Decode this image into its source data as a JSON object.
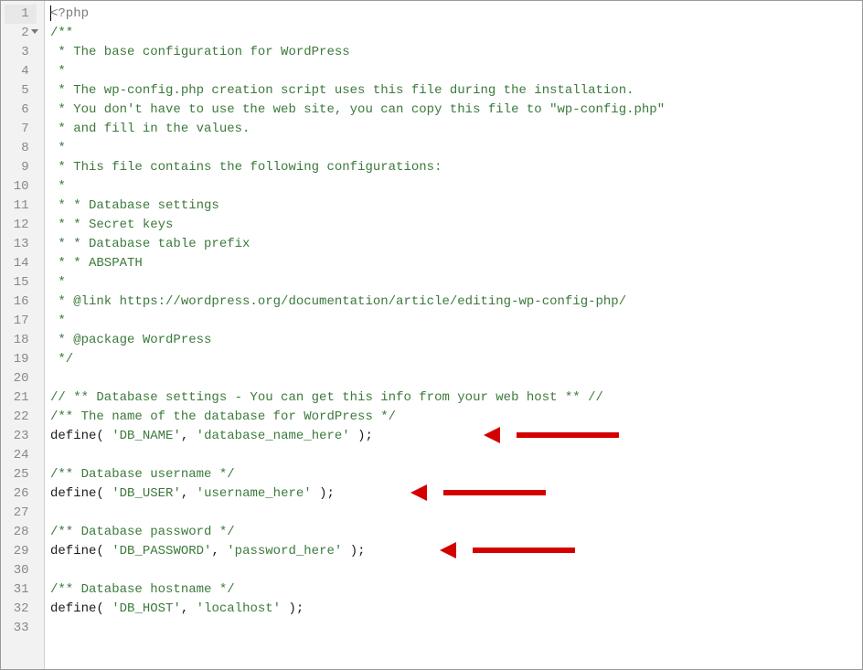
{
  "editor": {
    "total_lines": 33,
    "highlighted_line": 1,
    "fold_marker_line": 2,
    "lines": {
      "l1_open": "<?php",
      "l2": "/**",
      "l3": " * The base configuration for WordPress",
      "l4": " *",
      "l5": " * The wp-config.php creation script uses this file during the installation.",
      "l6": " * You don't have to use the web site, you can copy this file to \"wp-config.php\"",
      "l7": " * and fill in the values.",
      "l8": " *",
      "l9": " * This file contains the following configurations:",
      "l10": " *",
      "l11": " * * Database settings",
      "l12": " * * Secret keys",
      "l13": " * * Database table prefix",
      "l14": " * * ABSPATH",
      "l15": " *",
      "l16": " * @link https://wordpress.org/documentation/article/editing-wp-config-php/",
      "l17": " *",
      "l18": " * @package WordPress",
      "l19": " */",
      "l20": "",
      "l21": "// ** Database settings - You can get this info from your web host ** //",
      "l22": "/** The name of the database for WordPress */",
      "l23_fn": "define",
      "l23_a1": "'DB_NAME'",
      "l23_a2": "'database_name_here'",
      "l24": "",
      "l25": "/** Database username */",
      "l26_fn": "define",
      "l26_a1": "'DB_USER'",
      "l26_a2": "'username_here'",
      "l27": "",
      "l28": "/** Database password */",
      "l29_fn": "define",
      "l29_a1": "'DB_PASSWORD'",
      "l29_a2": "'password_here'",
      "l30": "",
      "l31": "/** Database hostname */",
      "l32_fn": "define",
      "l32_a1": "'DB_HOST'",
      "l32_a2": "'localhost'",
      "l33": ""
    }
  },
  "annotations": {
    "arrow_targets": [
      "db-name-define",
      "db-user-define",
      "db-password-define"
    ]
  }
}
